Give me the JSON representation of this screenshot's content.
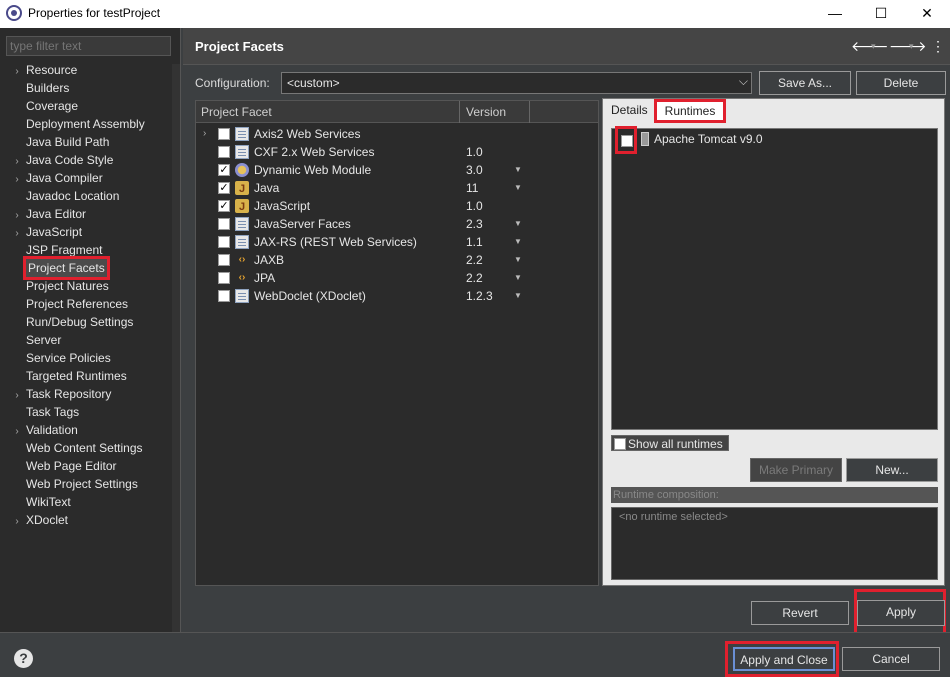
{
  "window": {
    "title": "Properties for testProject",
    "minimize": "—",
    "maximize": "☐",
    "close": "✕"
  },
  "left": {
    "filter_placeholder": "type filter text",
    "items": [
      {
        "label": "Resource",
        "expandable": true
      },
      {
        "label": "Builders",
        "expandable": false
      },
      {
        "label": "Coverage",
        "expandable": false
      },
      {
        "label": "Deployment Assembly",
        "expandable": false
      },
      {
        "label": "Java Build Path",
        "expandable": false
      },
      {
        "label": "Java Code Style",
        "expandable": true
      },
      {
        "label": "Java Compiler",
        "expandable": true
      },
      {
        "label": "Javadoc Location",
        "expandable": false
      },
      {
        "label": "Java Editor",
        "expandable": true
      },
      {
        "label": "JavaScript",
        "expandable": true
      },
      {
        "label": "JSP Fragment",
        "expandable": false
      },
      {
        "label": "Project Facets",
        "expandable": false,
        "selected": true
      },
      {
        "label": "Project Natures",
        "expandable": false
      },
      {
        "label": "Project References",
        "expandable": false
      },
      {
        "label": "Run/Debug Settings",
        "expandable": false
      },
      {
        "label": "Server",
        "expandable": false
      },
      {
        "label": "Service Policies",
        "expandable": false
      },
      {
        "label": "Targeted Runtimes",
        "expandable": false
      },
      {
        "label": "Task Repository",
        "expandable": true
      },
      {
        "label": "Task Tags",
        "expandable": false
      },
      {
        "label": "Validation",
        "expandable": true
      },
      {
        "label": "Web Content Settings",
        "expandable": false
      },
      {
        "label": "Web Page Editor",
        "expandable": false
      },
      {
        "label": "Web Project Settings",
        "expandable": false
      },
      {
        "label": "WikiText",
        "expandable": false
      },
      {
        "label": "XDoclet",
        "expandable": true
      }
    ]
  },
  "page": {
    "title": "Project Facets",
    "back_icon": "🡐",
    "forward_icon": "🡒",
    "menu_icon": "⋮",
    "config_label": "Configuration:",
    "config_value": "<custom>",
    "save_as": "Save As...",
    "delete": "Delete"
  },
  "facets": {
    "col_facet": "Project Facet",
    "col_version": "Version",
    "rows": [
      {
        "name": "Axis2 Web Services",
        "version": "",
        "checked": false,
        "icon": "doc",
        "expandable": true,
        "dropdown": false
      },
      {
        "name": "CXF 2.x Web Services",
        "version": "1.0",
        "checked": false,
        "icon": "doc",
        "expandable": false,
        "dropdown": false
      },
      {
        "name": "Dynamic Web Module",
        "version": "3.0",
        "checked": true,
        "icon": "gear",
        "expandable": false,
        "dropdown": true
      },
      {
        "name": "Java",
        "version": "11",
        "checked": true,
        "icon": "java",
        "expandable": false,
        "dropdown": true
      },
      {
        "name": "JavaScript",
        "version": "1.0",
        "checked": true,
        "icon": "java",
        "expandable": false,
        "dropdown": false
      },
      {
        "name": "JavaServer Faces",
        "version": "2.3",
        "checked": false,
        "icon": "doc",
        "expandable": false,
        "dropdown": true
      },
      {
        "name": "JAX-RS (REST Web Services)",
        "version": "1.1",
        "checked": false,
        "icon": "doc",
        "expandable": false,
        "dropdown": true
      },
      {
        "name": "JAXB",
        "version": "2.2",
        "checked": false,
        "icon": "xml",
        "expandable": false,
        "dropdown": true
      },
      {
        "name": "JPA",
        "version": "2.2",
        "checked": false,
        "icon": "xml",
        "expandable": false,
        "dropdown": true
      },
      {
        "name": "WebDoclet (XDoclet)",
        "version": "1.2.3",
        "checked": false,
        "icon": "doc",
        "expandable": false,
        "dropdown": true
      }
    ]
  },
  "runtimes": {
    "tab_details": "Details",
    "tab_runtimes": "Runtimes",
    "items": [
      {
        "name": "Apache Tomcat v9.0",
        "checked": false
      }
    ],
    "show_all": "Show all runtimes",
    "make_primary": "Make Primary",
    "new": "New...",
    "composition_label": "Runtime composition:",
    "composition_value": "<no runtime selected>"
  },
  "buttons": {
    "revert": "Revert",
    "apply": "Apply",
    "apply_close": "Apply and Close",
    "cancel": "Cancel",
    "help": "?"
  }
}
